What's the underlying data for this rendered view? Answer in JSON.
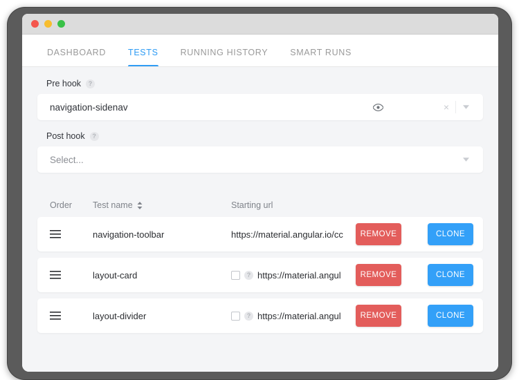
{
  "window": {
    "traffic_lights": [
      "close",
      "minimize",
      "maximize"
    ]
  },
  "tabs": [
    {
      "label": "DASHBOARD",
      "active": false
    },
    {
      "label": "TESTS",
      "active": true
    },
    {
      "label": "RUNNING HISTORY",
      "active": false
    },
    {
      "label": "SMART RUNS",
      "active": false
    }
  ],
  "colors": {
    "accent_blue": "#2f9cf4",
    "button_blue": "#33a0f8",
    "button_red": "#e35d5b",
    "page_bg": "#f4f5f7",
    "title_bar": "#dcdcdc",
    "frame": "#5b5b5b"
  },
  "pre_hook": {
    "label": "Pre hook",
    "help": "?",
    "value": "navigation-sidenav",
    "eye_icon": "eye-icon",
    "clear_icon": "×",
    "caret_icon": "chevron-down-icon"
  },
  "post_hook": {
    "label": "Post hook",
    "help": "?",
    "placeholder": "Select...",
    "caret_icon": "chevron-down-icon"
  },
  "table": {
    "headers": {
      "order": "Order",
      "test_name": "Test name",
      "starting_url": "Starting url"
    },
    "rows": [
      {
        "drag_handle": "drag-handle-icon",
        "name": "navigation-toolbar",
        "has_checkbox": false,
        "checkbox_checked": false,
        "has_help": false,
        "help": "?",
        "url": "https://material.angular.io/cc",
        "remove_label": "REMOVE",
        "clone_label": "CLONE"
      },
      {
        "drag_handle": "drag-handle-icon",
        "name": "layout-card",
        "has_checkbox": true,
        "checkbox_checked": false,
        "has_help": true,
        "help": "?",
        "url": "https://material.angul",
        "remove_label": "REMOVE",
        "clone_label": "CLONE"
      },
      {
        "drag_handle": "drag-handle-icon",
        "name": "layout-divider",
        "has_checkbox": true,
        "checkbox_checked": false,
        "has_help": true,
        "help": "?",
        "url": "https://material.angul",
        "remove_label": "REMOVE",
        "clone_label": "CLONE"
      }
    ]
  }
}
